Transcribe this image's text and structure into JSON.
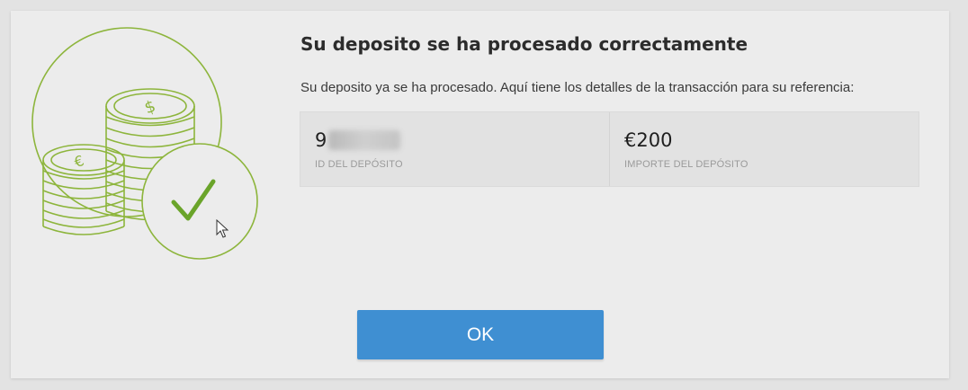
{
  "dialog": {
    "title": "Su deposito se ha procesado correctamente",
    "message": "Su deposito ya se ha procesado. Aquí tiene los detalles de la transacción para su referencia:",
    "deposit_id": {
      "value_visible": "9",
      "label": "ID DEL DEPÓSITO"
    },
    "deposit_amount": {
      "value": "€200",
      "label": "IMPORTE DEL DEPÓSITO"
    },
    "ok_label": "OK",
    "illustration": {
      "icon": "coins-checkmark-icon",
      "euro_symbol": "€",
      "dollar_symbol": "$",
      "accent_color": "#8db53c",
      "check_color": "#6aa42a"
    },
    "button_color": "#3f8fd2"
  }
}
